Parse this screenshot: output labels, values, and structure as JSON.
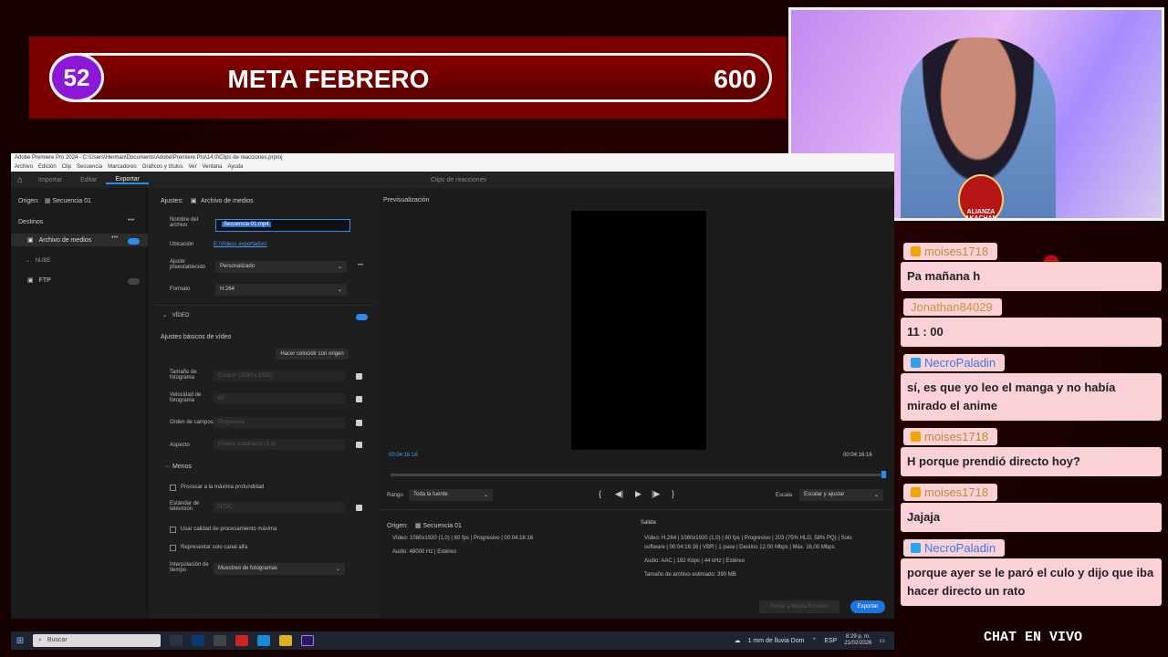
{
  "goal": {
    "count": "52",
    "title": "META FEBRERO",
    "target": "600"
  },
  "webcam": {
    "logo_text": "ALIANZA AKACHAN"
  },
  "chat": {
    "messages": [
      {
        "user": "moises1718",
        "text": "Pa mañana h"
      },
      {
        "user": "Jonathan84029",
        "text": "11 : 00"
      },
      {
        "user": "NecroPaladin",
        "text": "sí, es que yo leo el manga y no había mirado el anime"
      },
      {
        "user": "moises1718",
        "text": "H porque prendió directo hoy?"
      },
      {
        "user": "moises1718",
        "text": "Jajaja"
      },
      {
        "user": "NecroPaladin",
        "text": "porque ayer se le paró el culo y dijo que iba hacer directo un rato"
      }
    ],
    "footer": "CHAT EN VIVO"
  },
  "premiere": {
    "titlebar": "Adobe Premiere Pro 2024 - C:\\Users\\Herman\\Documents\\Adobe\\Premiere Pro\\14.0\\Clips de reacciones.prproj",
    "menu": [
      "Archivo",
      "Edición",
      "Clip",
      "Secuencia",
      "Marcadores",
      "Gráficos y títulos",
      "Ver",
      "Ventana",
      "Ayuda"
    ],
    "tabs": [
      "Importar",
      "Editar",
      "Exportar"
    ],
    "project": "Clips de reacciones",
    "origin_label": "Origen:",
    "origin_value": "Secuencia 01",
    "destinations_label": "Destinos",
    "dest_media": "Archivo de medios",
    "dest_group": "NUBE",
    "dest_ftp": "FTP",
    "settings_label": "Ajustes:",
    "settings_value": "Archivo de medios",
    "filename_label": "Nombre del archivo",
    "filename_value": "Secuencia 01.mp4",
    "location_label": "Ubicación",
    "location_value": "E:\\Videos exportados\\",
    "preset_label": "Ajuste preestablecido",
    "preset_value": "Personalizado",
    "format_label": "Formato",
    "format_value": "H.264",
    "video_section": "VÍDEO",
    "video_basic": "Ajustes básicos de vídeo",
    "match_source": "Hacer coincidir con origen",
    "frame_size_label": "Tamaño de fotograma",
    "frame_size_value": "Custom (1080 x 1920)",
    "frame_rate_label": "Velocidad de fotograma",
    "frame_rate_value": "60",
    "field_order_label": "Orden de campos",
    "field_order_value": "Progresivo",
    "aspect_label": "Aspecto",
    "aspect_value": "Píxeles cuadrados (1,0)",
    "less_label": "Menos",
    "max_depth": "Procesar a la máxima profundidad",
    "tv_standard_label": "Estándar de televisión",
    "tv_standard_value": "NTSC",
    "max_quality": "Usar calidad de procesamiento máxima",
    "alpha_only": "Representar solo canal alfa",
    "interp_label": "Interpolación de tiempo",
    "interp_value": "Muestreo de fotogramas",
    "preview_label": "Previsualización",
    "time_start": "00:04:16:16",
    "time_end": "00:04:16:16",
    "range_label": "Rango",
    "range_value": "Toda la fuente",
    "scale_label": "Escala",
    "scale_value": "Escalar y ajustar",
    "src_origin_label": "Origen:",
    "src_origin_value": "Secuencia 01",
    "src_video": "Vídeo:  1080x1920 (1,0)  |  60 fps  |  Progresivo  |  00:04:16:16",
    "src_audio": "Audio:  48000 Hz  |  Estéreo",
    "out_label": "Salida",
    "out_video": "Vídeo:  H.264  |  1080x1920 (1,0)  |  60 fps  |  Progresivo  |  203 (75% HLG, 58% PQ)  |  Solo software  |  00:04:16:16  |  VBR  |  1 pase  |  Destino 12,00 Mbps  |  Máx. 16,00 Mbps",
    "out_audio": "Audio:  AAC  |  192 Kbps  |  44 kHz  |  Estéreo",
    "out_size": "Tamaño de archivo estimado:  390 MB",
    "queue_button": "Enviar a Media Encoder",
    "export_button": "Exportar"
  },
  "taskbar": {
    "search_placeholder": "Buscar",
    "weather": "1 mm de lluvia Dom",
    "lang": "ESP",
    "time": "8:29 p. m.",
    "date": "21/02/2026"
  }
}
